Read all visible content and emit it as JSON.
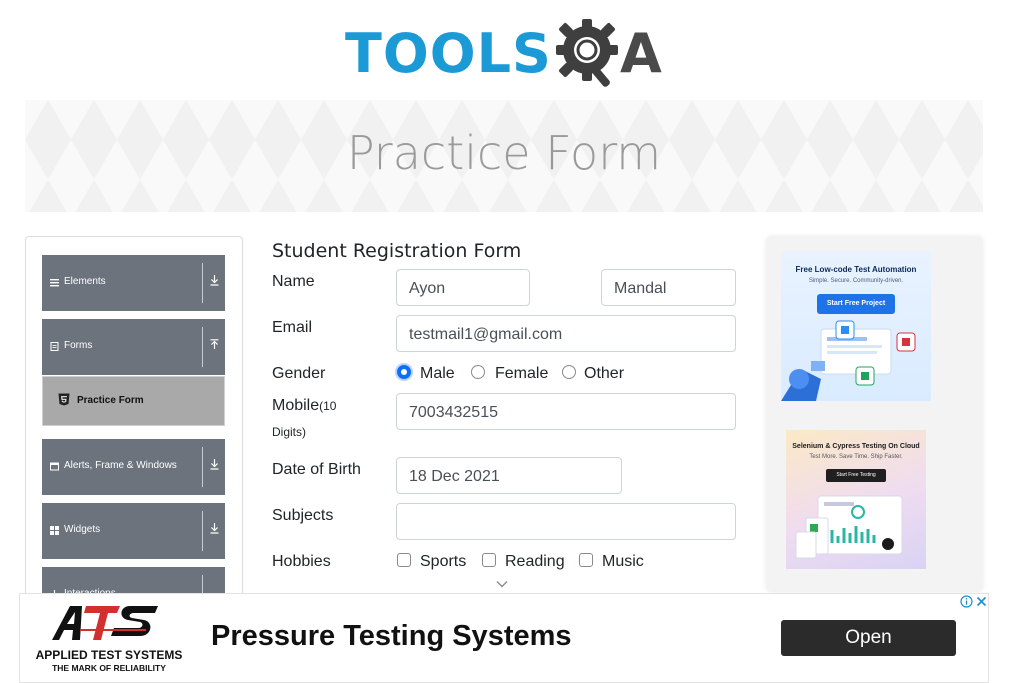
{
  "header": {
    "logo_text_left": "TOOLS",
    "logo_text_right": "A",
    "banner_title": "Practice Form"
  },
  "sidebar": {
    "groups": [
      {
        "label": "Elements",
        "icon": "hamburger-icon",
        "arrow": "expand"
      },
      {
        "label": "Forms",
        "icon": "document-icon",
        "arrow": "collapse"
      },
      {
        "label": "Alerts, Frame & Windows",
        "icon": "window-icon",
        "arrow": "expand"
      },
      {
        "label": "Widgets",
        "icon": "grid-icon",
        "arrow": "expand"
      },
      {
        "label": "Interactions",
        "icon": "arrows-icon",
        "arrow": "expand"
      }
    ],
    "active_item": {
      "label": "Practice Form",
      "icon": "html5-icon"
    }
  },
  "form": {
    "title": "Student Registration Form",
    "name_label": "Name",
    "first_name": "Ayon",
    "last_name": "Mandal",
    "email_label": "Email",
    "email": "testmail1@gmail.com",
    "gender_label": "Gender",
    "gender_options": [
      "Male",
      "Female",
      "Other"
    ],
    "gender_selected": "Male",
    "mobile_label": "Mobile",
    "mobile_hint_a": "(10",
    "mobile_hint_b": "Digits)",
    "mobile": "7003432515",
    "dob_label": "Date of Birth",
    "dob": "18 Dec 2021",
    "subjects_label": "Subjects",
    "subjects": "",
    "hobbies_label": "Hobbies",
    "hobby_options": [
      "Sports",
      "Reading",
      "Music"
    ],
    "hobbies_checked": []
  },
  "side_ads": {
    "ad1": {
      "headline": "Free Low-code Test Automation",
      "sub": "Simple. Secure. Community-driven.",
      "cta": "Start Free Project"
    },
    "ad2": {
      "headline": "Selenium & Cypress Testing On Cloud",
      "sub": "Test More. Save Time. Ship Faster.",
      "cta": "Start Free Testing"
    }
  },
  "bottom_ad": {
    "brand": "APPLIED TEST SYSTEMS",
    "tagline": "THE MARK OF RELIABILITY",
    "headline": "Pressure Testing Systems",
    "cta": "Open"
  },
  "colors": {
    "logo_blue": "#1b9ad6",
    "sidebar_group_bg": "#6c737d",
    "active_item_bg": "#a9a9a9",
    "radio_checked": "#0d6efd",
    "ats_red": "#d32f2f"
  }
}
